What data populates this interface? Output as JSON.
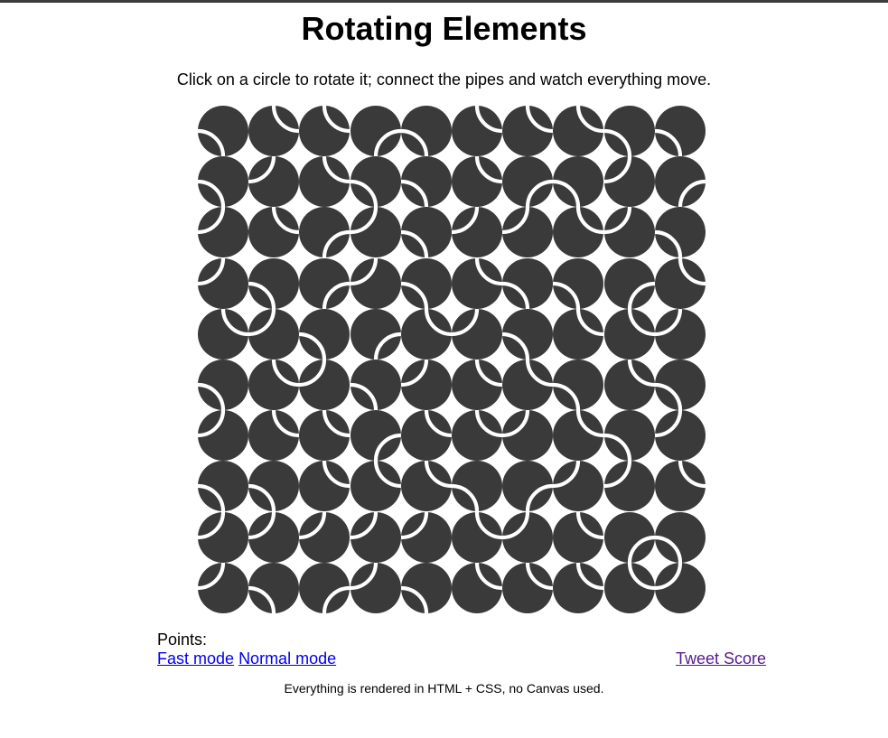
{
  "page": {
    "title": "Rotating Elements",
    "subtitle": "Click on a circle to rotate it; connect the pipes and watch everything move."
  },
  "colors": {
    "tile": "#3a3a3a",
    "pipe": "#ffffff",
    "link": "#0000ee",
    "visited_link": "#551a8b"
  },
  "board": {
    "rows": 10,
    "cols": 10,
    "tiles": [
      [
        "bl",
        "tr",
        "tr",
        "br",
        "bl",
        "tr",
        "tr",
        "tr",
        "bl",
        "bl"
      ],
      [
        "bl",
        "tl",
        "tr",
        "bl",
        "bl",
        "tr",
        "br",
        "bl",
        "tl",
        "br"
      ],
      [
        "tl",
        "tr",
        "br",
        "tl",
        "bl",
        "tl",
        "tl",
        "tr",
        "tl",
        "bl"
      ],
      [
        "tl",
        "bl",
        "br",
        "tl",
        "bl",
        "tr",
        "bl",
        "bl",
        "br",
        "tr"
      ],
      [
        "tr",
        "tl",
        "bl",
        "br",
        "tr",
        "tl",
        "bl",
        "tr",
        "tr",
        "tl"
      ],
      [
        "bl",
        "tr",
        "tl",
        "bl",
        "tl",
        "tr",
        "tr",
        "bl",
        "tr",
        "bl"
      ],
      [
        "tl",
        "tr",
        "tr",
        "br",
        "tr",
        "tr",
        "tl",
        "tr",
        "bl",
        "tl"
      ],
      [
        "bl",
        "bl",
        "tr",
        "tr",
        "tr",
        "bl",
        "br",
        "tl",
        "tl",
        "tr"
      ],
      [
        "tl",
        "tl",
        "tl",
        "tl",
        "tl",
        "tr",
        "tl",
        "tr",
        "br",
        "bl"
      ],
      [
        "tl",
        "bl",
        "br",
        "tl",
        "bl",
        "tr",
        "tr",
        "tr",
        "tr",
        "tl"
      ]
    ]
  },
  "score": {
    "label": "Points:",
    "value": ""
  },
  "links": {
    "fast_mode": "Fast mode",
    "normal_mode": "Normal mode",
    "tweet": "Tweet Score"
  },
  "footer": {
    "note": "Everything is rendered in HTML + CSS, no Canvas used."
  }
}
